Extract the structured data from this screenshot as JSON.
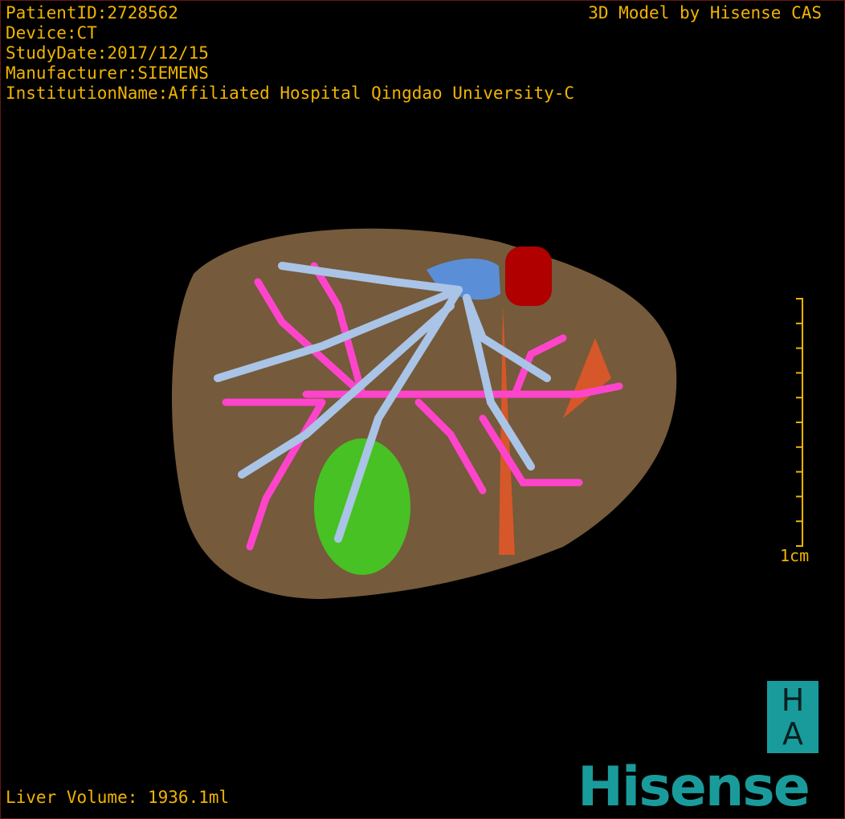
{
  "overlay": {
    "patient_id": "PatientID:2728562",
    "device": "Device:CT",
    "study_date": "StudyDate:2017/12/15",
    "manufacturer": "Manufacturer:SIEMENS",
    "institution": "InstitutionName:Affiliated Hospital Qingdao University-C",
    "brand": "3D Model by Hisense CAS",
    "liver_volume": "Liver Volume: 1936.1ml"
  },
  "scale_bar": {
    "label": "1cm"
  },
  "logo": {
    "ha_top": "H",
    "ha_bottom": "A",
    "text": "Hisense"
  },
  "colors": {
    "text": "#f0b400",
    "liver": "#8a6a45",
    "portal_vein": "#ff44cc",
    "hepatic_vein": "#a9c4e6",
    "ivc": "#5a8fd8",
    "aorta": "#c00000",
    "gallbladder": "#44cc22",
    "artery": "#ff5522",
    "brand": "#1a9b9b"
  }
}
